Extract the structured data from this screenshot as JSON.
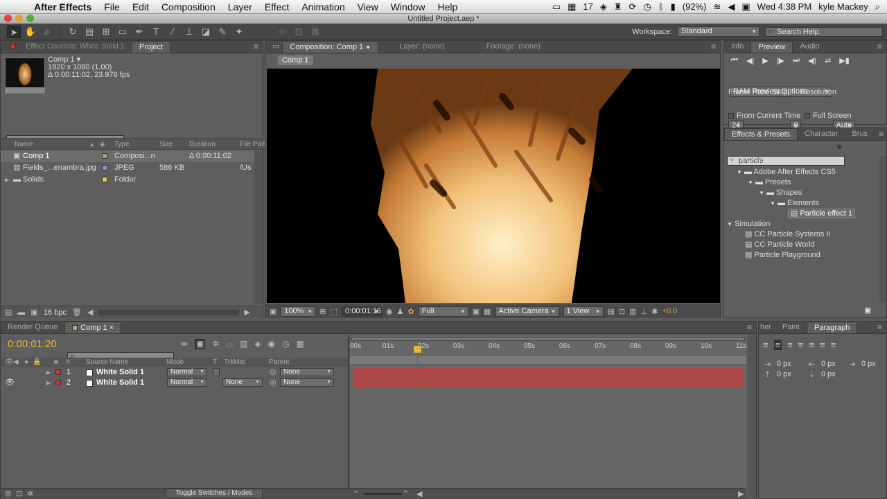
{
  "menubar": {
    "app": "After Effects",
    "items": [
      "File",
      "Edit",
      "Composition",
      "Layer",
      "Effect",
      "Animation",
      "View",
      "Window",
      "Help"
    ],
    "calendar_badge": "17",
    "battery": "(92%)",
    "clock": "Wed 4:38 PM",
    "user": "kyle Mackey"
  },
  "window_title": "Untitled Project.aep *",
  "toolbar": {
    "workspace_label": "Workspace:",
    "workspace_value": "Standard",
    "search_help": "Search Help"
  },
  "project_panel": {
    "tabs": [
      "Effect Controls: White Solid 1",
      "Project"
    ],
    "comp_name": "Comp 1 ▾",
    "comp_res": "1920 x 1080 (1.00)",
    "comp_duration": "Δ 0:00:11:02, 23.976 fps",
    "columns": [
      "Name",
      "Type",
      "Size",
      "Duration",
      "File Path"
    ],
    "items": [
      {
        "name": "Comp 1",
        "type": "Composi...n",
        "size": "",
        "duration": "Δ 0:00:11:02",
        "path": "",
        "color": "#b0a080"
      },
      {
        "name": "Fields_...enambra.jpg",
        "type": "JPEG",
        "size": "586 KB",
        "duration": "",
        "path": "/Us",
        "color": "#9090d0"
      },
      {
        "name": "Solids",
        "type": "Folder",
        "size": "",
        "duration": "",
        "path": "",
        "color": "#e0d040"
      }
    ],
    "bpc": "16 bpc"
  },
  "comp_panel": {
    "tabs": [
      "Composition: Comp 1",
      "Layer: (none)",
      "Footage: (none)"
    ],
    "breadcrumb": "Comp 1",
    "zoom": "100%",
    "timecode": "0:00:01:16",
    "resolution": "Full",
    "camera": "Active Camera",
    "views": "1 View",
    "exposure": "+0.0"
  },
  "preview_panel": {
    "tabs": [
      "Info",
      "Preview",
      "Audio"
    ],
    "ram_options": "RAM Preview Options",
    "frame_rate_label": "Frame Rate",
    "skip_label": "Skip",
    "resolution_label": "Resolution",
    "frame_rate": "24",
    "skip": "0",
    "resolution": "Auto",
    "from_current": "From Current Time",
    "full_screen": "Full Screen"
  },
  "effects_panel": {
    "tabs": [
      "Effects & Presets",
      "Character",
      "Brus"
    ],
    "search": "particle",
    "tree": [
      {
        "label": "* Animation Presets",
        "depth": 0,
        "kind": "open"
      },
      {
        "label": "Adobe After Effects CS5",
        "depth": 1,
        "kind": "folder"
      },
      {
        "label": "Presets",
        "depth": 2,
        "kind": "folder"
      },
      {
        "label": "Shapes",
        "depth": 3,
        "kind": "folder"
      },
      {
        "label": "Elements",
        "depth": 4,
        "kind": "folder"
      },
      {
        "label": "Particle effect 1",
        "depth": 5,
        "kind": "preset"
      },
      {
        "label": "Simulation",
        "depth": 0,
        "kind": "open"
      },
      {
        "label": "CC Particle Systems II",
        "depth": 1,
        "kind": "effect"
      },
      {
        "label": "CC Particle World",
        "depth": 1,
        "kind": "effect"
      },
      {
        "label": "Particle Playground",
        "depth": 1,
        "kind": "effect"
      }
    ]
  },
  "timeline": {
    "tabs": [
      "Render Queue",
      "Comp 1"
    ],
    "current_time": "0:00:01:20",
    "columns": {
      "num": "#",
      "source": "Source Name",
      "mode": "Mode",
      "t": "T",
      "trkmat": "TrkMat",
      "parent": "Parent"
    },
    "layers": [
      {
        "num": "1",
        "name": "White Solid 1",
        "mode": "Normal",
        "trkmat": "",
        "parent": "None"
      },
      {
        "num": "2",
        "name": "White Solid 1",
        "mode": "Normal",
        "trkmat": "None",
        "parent": "None"
      }
    ],
    "ruler": [
      "00s",
      "01s",
      "02s",
      "03s",
      "04s",
      "05s",
      "06s",
      "07s",
      "08s",
      "09s",
      "10s",
      "11s"
    ],
    "playhead_seconds": 1.83,
    "toggle_label": "Toggle Switches / Modes"
  },
  "paragraph_panel": {
    "tabs": [
      "her",
      "Paint",
      "Paragraph"
    ],
    "indent_values": [
      "0 px",
      "0 px",
      "0 px",
      "0 px",
      "0 px"
    ]
  }
}
